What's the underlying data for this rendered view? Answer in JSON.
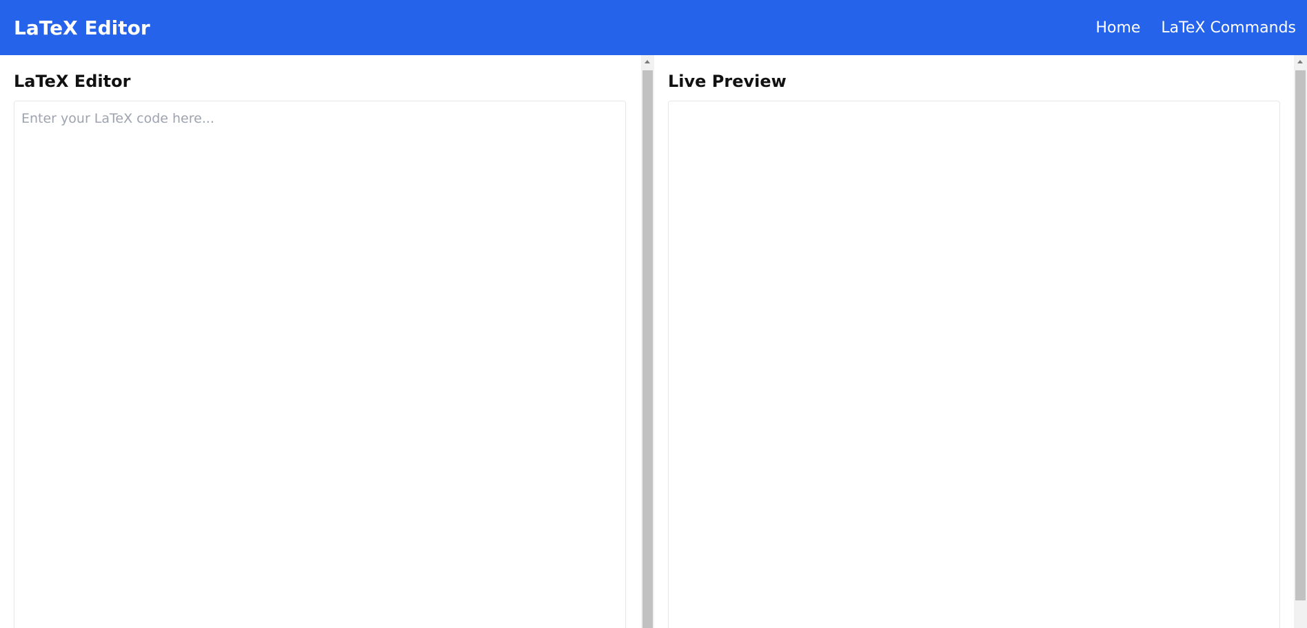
{
  "navbar": {
    "brand": "LaTeX Editor",
    "links": [
      "Home",
      "LaTeX Commands"
    ],
    "background_color": "#2563eb"
  },
  "editor": {
    "title": "LaTeX Editor",
    "value": "",
    "placeholder": "Enter your LaTeX code here..."
  },
  "preview": {
    "title": "Live Preview"
  }
}
